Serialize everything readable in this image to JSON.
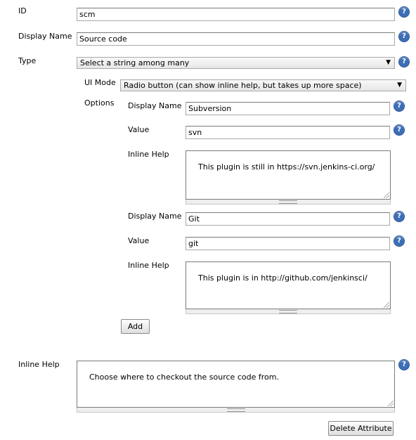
{
  "labels": {
    "id": "ID",
    "display_name": "Display Name",
    "type": "Type",
    "ui_mode": "UI Mode",
    "options": "Options",
    "opt_display_name": "Display Name",
    "opt_value": "Value",
    "opt_inline_help": "Inline Help",
    "inline_help": "Inline Help"
  },
  "fields": {
    "id_value": "scm",
    "display_name_value": "Source code",
    "type_selected": "Select a string among many",
    "ui_mode_selected": "Radio button (can show inline help, but takes up more space)",
    "inline_help_value": "Choose where to checkout the source code from."
  },
  "options": [
    {
      "display_name": "Subversion",
      "value": "svn",
      "inline_help": "This plugin is still in https://svn.jenkins-ci.org/"
    },
    {
      "display_name": "Git",
      "value": "git",
      "inline_help": "This plugin is in http://github.com/jenkinsci/"
    }
  ],
  "buttons": {
    "add": "Add",
    "delete_attribute": "Delete Attribute"
  },
  "icons": {
    "help": "?",
    "dropdown": "▼"
  },
  "colors": {
    "help_icon": "#3d6fb7"
  }
}
